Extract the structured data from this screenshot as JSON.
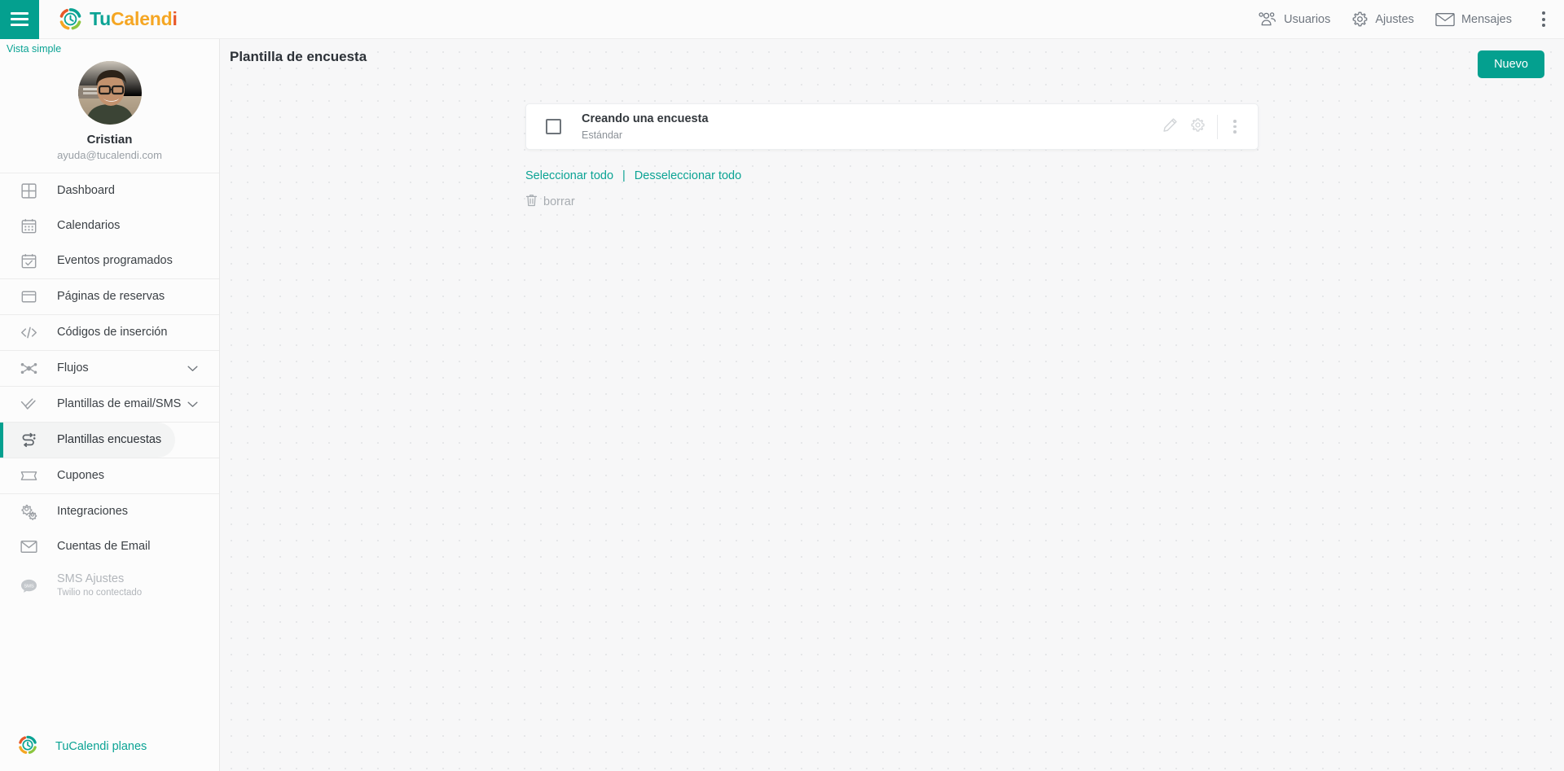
{
  "topbar": {
    "menu_icon": "hamburger-icon",
    "brand": {
      "part1": "Tu",
      "part2": "Calend",
      "part3": "i",
      "logo_icon": "tucalendi-logo-icon"
    },
    "items": [
      {
        "label": "Usuarios",
        "icon": "users-icon"
      },
      {
        "label": "Ajustes",
        "icon": "gear-icon"
      },
      {
        "label": "Mensajes",
        "icon": "envelope-icon"
      }
    ],
    "overflow_icon": "kebab-menu-icon"
  },
  "sidebar": {
    "vista_simple": "Vista simple",
    "profile": {
      "name": "Cristian",
      "email": "ayuda@tucalendi.com",
      "avatar_icon": "user-avatar-photo"
    },
    "items": [
      {
        "label": "Dashboard",
        "icon": "dashboard-grid-icon",
        "active": false
      },
      {
        "label": "Calendarios",
        "icon": "calendar-icon",
        "active": false
      },
      {
        "label": "Eventos programados",
        "icon": "calendar-check-icon",
        "active": false
      },
      {
        "label": "Páginas de reservas",
        "icon": "browser-window-icon",
        "active": false
      },
      {
        "label": "Códigos de inserción",
        "icon": "code-brackets-icon",
        "active": false
      },
      {
        "label": "Flujos",
        "icon": "flows-nodes-icon",
        "active": false,
        "chevron": true
      },
      {
        "label": "Plantillas de email/SMS",
        "icon": "double-check-icon",
        "active": false,
        "chevron": true
      },
      {
        "label": "Plantillas encuestas",
        "icon": "survey-arrows-icon",
        "active": true
      },
      {
        "label": "Cupones",
        "icon": "ticket-icon",
        "active": false
      },
      {
        "label": "Integraciones",
        "icon": "gears-icon",
        "active": false
      },
      {
        "label": "Cuentas de Email",
        "icon": "envelope-icon",
        "active": false
      },
      {
        "label": "SMS Ajustes",
        "sublabel": "Twilio no contectado",
        "icon": "sms-bubble-icon",
        "active": false,
        "disabled": true
      }
    ],
    "footer": {
      "label": "TuCalendi planes",
      "icon": "tucalendi-logo-icon"
    }
  },
  "main": {
    "page_title": "Plantilla de encuesta",
    "new_button": "Nuevo",
    "card": {
      "title": "Creando una encuesta",
      "subtitle": "Estándar",
      "checkbox_checked": false,
      "edit_icon": "pencil-icon",
      "settings_icon": "gear-icon",
      "more_icon": "kebab-menu-icon"
    },
    "select_all": "Seleccionar todo",
    "separator": "|",
    "deselect_all": "Desseleccionar todo",
    "delete_label": "borrar",
    "delete_icon": "trash-icon"
  },
  "colors": {
    "teal": "#04a08f",
    "teal_link": "#0ba394",
    "orange": "#e8582a",
    "yellow": "#f5a623",
    "green": "#8cc63f",
    "background": "#f7f7f8"
  }
}
